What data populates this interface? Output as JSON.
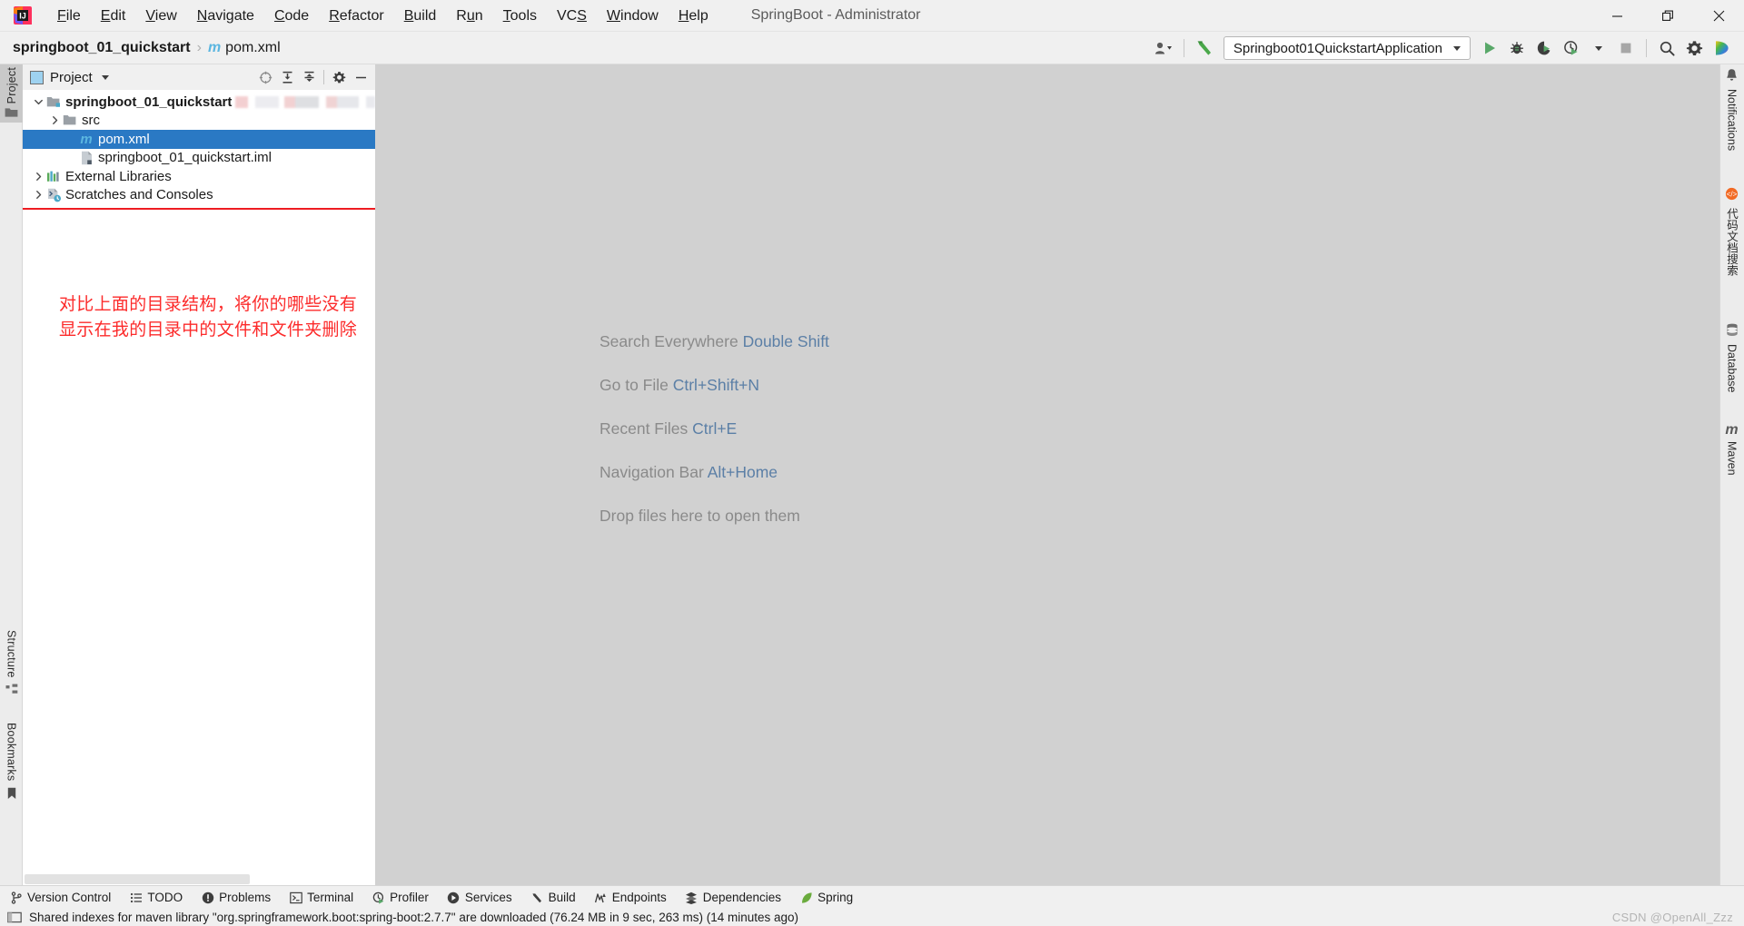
{
  "window": {
    "title": "SpringBoot - Administrator",
    "logo_icon": "intellij-idea-logo",
    "controls": [
      {
        "name": "minimize-button",
        "icon": "minimize-icon"
      },
      {
        "name": "restore-button",
        "icon": "restore-icon"
      },
      {
        "name": "close-button",
        "icon": "close-icon"
      }
    ]
  },
  "menubar": {
    "items": [
      {
        "label": "File",
        "mnemonic": "F"
      },
      {
        "label": "Edit",
        "mnemonic": "E"
      },
      {
        "label": "View",
        "mnemonic": "V"
      },
      {
        "label": "Navigate",
        "mnemonic": "N"
      },
      {
        "label": "Code",
        "mnemonic": "C"
      },
      {
        "label": "Refactor",
        "mnemonic": "R"
      },
      {
        "label": "Build",
        "mnemonic": "B"
      },
      {
        "label": "Run",
        "mnemonic": "u"
      },
      {
        "label": "Tools",
        "mnemonic": "T"
      },
      {
        "label": "VCS",
        "mnemonic": "S"
      },
      {
        "label": "Window",
        "mnemonic": "W"
      },
      {
        "label": "Help",
        "mnemonic": "H"
      }
    ]
  },
  "breadcrumb": {
    "project": "springboot_01_quickstart",
    "separator": "›",
    "file_icon_letter": "m",
    "file": "pom.xml"
  },
  "toolbar": {
    "account_icon": "user-account-icon",
    "build_icon": "build-hammer-icon",
    "run_config": {
      "label": "Springboot01QuickstartApplication",
      "caret_icon": "chevron-down-icon"
    },
    "actions": [
      {
        "name": "run-button",
        "icon": "run-play-icon",
        "enabled": true
      },
      {
        "name": "debug-button",
        "icon": "debug-bug-icon",
        "enabled": true
      },
      {
        "name": "run-coverage-button",
        "icon": "coverage-icon",
        "enabled": true
      },
      {
        "name": "profiler-button",
        "icon": "profiler-clock-icon",
        "enabled": true
      },
      {
        "name": "stop-button",
        "icon": "stop-square-icon",
        "enabled": false
      },
      {
        "name": "search-button",
        "icon": "search-icon",
        "enabled": true
      },
      {
        "name": "settings-button",
        "icon": "gear-icon",
        "enabled": true
      },
      {
        "name": "updates-button",
        "icon": "colorful-play-icon",
        "enabled": true
      }
    ]
  },
  "left_strip": {
    "tabs": [
      {
        "label": "Project",
        "icon": "project-folder-icon",
        "active": true
      },
      {
        "label": "Structure",
        "icon": "structure-icon",
        "active": false
      },
      {
        "label": "Bookmarks",
        "icon": "bookmark-icon",
        "active": false
      }
    ]
  },
  "right_strip": {
    "tabs": [
      {
        "label": "Notifications",
        "icon": "bell-icon"
      },
      {
        "label": "代码文档搜索",
        "icon": "code-doc-search-icon"
      },
      {
        "label": "Database",
        "icon": "database-icon"
      },
      {
        "label": "Maven",
        "icon": "maven-m-icon"
      }
    ]
  },
  "project_panel": {
    "title": "Project",
    "title_icon": "project-view-icon",
    "title_caret": "chevron-down-icon",
    "header_actions": [
      {
        "name": "select-opened-file-button",
        "icon": "locate-target-icon"
      },
      {
        "name": "expand-all-button",
        "icon": "expand-all-icon"
      },
      {
        "name": "collapse-all-button",
        "icon": "collapse-all-icon"
      },
      {
        "name": "panel-settings-button",
        "icon": "gear-icon"
      },
      {
        "name": "hide-panel-button",
        "icon": "minimize-icon"
      }
    ],
    "tree": [
      {
        "label": "springboot_01_quickstart",
        "icon": "module-folder-icon",
        "arrow": "expanded",
        "indent": 0,
        "bold": true,
        "selected": false,
        "blurred_suffix": true
      },
      {
        "label": "src",
        "icon": "folder-icon",
        "arrow": "collapsed",
        "indent": 1,
        "bold": false,
        "selected": false,
        "blurred_suffix": false
      },
      {
        "label": "pom.xml",
        "icon": "maven-pom-icon",
        "arrow": "none",
        "indent": 2,
        "bold": false,
        "selected": true,
        "blurred_suffix": false
      },
      {
        "label": "springboot_01_quickstart.iml",
        "icon": "iml-file-icon",
        "arrow": "none",
        "indent": 2,
        "bold": false,
        "selected": false,
        "blurred_suffix": false
      },
      {
        "label": "External Libraries",
        "icon": "libraries-icon",
        "arrow": "collapsed",
        "indent": 0,
        "bold": false,
        "selected": false,
        "blurred_suffix": false
      },
      {
        "label": "Scratches and Consoles",
        "icon": "scratches-icon",
        "arrow": "collapsed",
        "indent": 0,
        "bold": false,
        "selected": false,
        "blurred_suffix": false
      }
    ],
    "annotation": {
      "line1": "对比上面的目录结构，将你的哪些没有",
      "line2": "显示在我的目录中的文件和文件夹删除",
      "color": "#fc2b2b"
    },
    "highlight_box_color": "#ee1c22"
  },
  "editor": {
    "hints": [
      {
        "label": "Search Everywhere",
        "key": "Double Shift"
      },
      {
        "label": "Go to File",
        "key": "Ctrl+Shift+N"
      },
      {
        "label": "Recent Files",
        "key": "Ctrl+E"
      },
      {
        "label": "Navigation Bar",
        "key": "Alt+Home"
      }
    ],
    "drop_hint": "Drop files here to open them",
    "label_color": "#8a8a8a",
    "key_color": "#5b7fa6",
    "background": "#d1d1d1"
  },
  "bottom_bar": {
    "items": [
      {
        "label": "Version Control",
        "icon": "branch-icon"
      },
      {
        "label": "TODO",
        "icon": "todo-list-icon"
      },
      {
        "label": "Problems",
        "icon": "problems-icon"
      },
      {
        "label": "Terminal",
        "icon": "terminal-icon"
      },
      {
        "label": "Profiler",
        "icon": "profiler-icon"
      },
      {
        "label": "Services",
        "icon": "services-icon"
      },
      {
        "label": "Build",
        "icon": "build-hammer-icon"
      },
      {
        "label": "Endpoints",
        "icon": "endpoints-icon"
      },
      {
        "label": "Dependencies",
        "icon": "dependencies-icon"
      },
      {
        "label": "Spring",
        "icon": "spring-leaf-icon"
      }
    ]
  },
  "status_bar": {
    "layout_icon": "layout-toggle-icon",
    "message": "Shared indexes for maven library \"org.springframework.boot:spring-boot:2.7.7\" are downloaded (76.24 MB in 9 sec, 263 ms) (14 minutes ago)",
    "watermark": "CSDN @OpenAll_Zzz"
  }
}
